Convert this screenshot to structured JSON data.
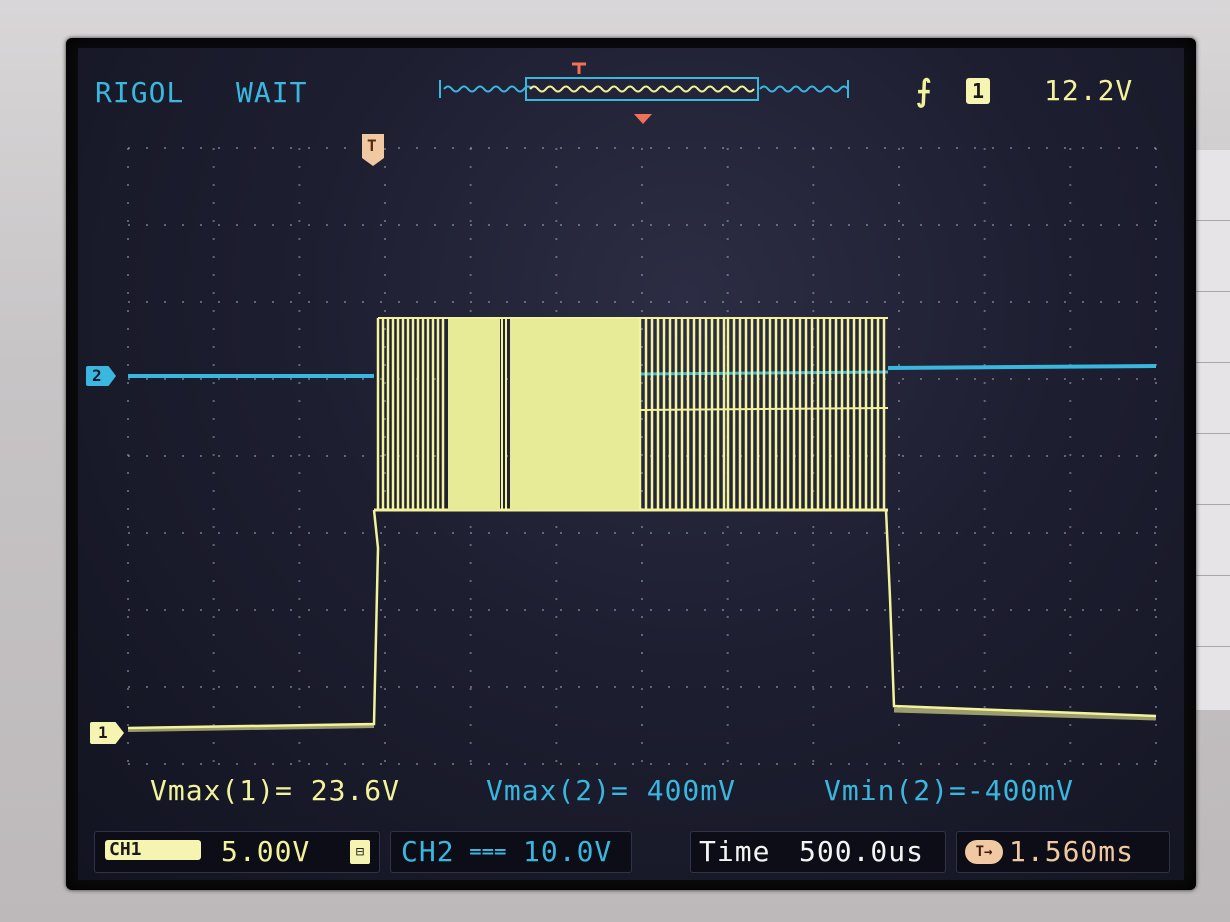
{
  "header": {
    "brand": "RIGOL",
    "status": "WAIT",
    "trigger_edge_icon": "rising-edge-icon",
    "trigger_source": "1",
    "trigger_level": "12.2V"
  },
  "markers": {
    "top_trigger": "T",
    "trigger_marker": "T",
    "ch2_marker": "2",
    "ch1_marker": "1"
  },
  "measurements": {
    "vmax1": "Vmax(1)= 23.6V",
    "vmax2": "Vmax(2)= 400mV",
    "vmin2": "Vmin(2)=-400mV"
  },
  "status_bar": {
    "ch1_label": "CH1",
    "ch1_scale": "5.00V",
    "ch1_coupling_icon": "bandwidth-limit-icon",
    "ch2_label": "CH2",
    "ch2_coupling_icon": "dc-coupling-icon",
    "ch2_scale": "10.0V",
    "time_label": "Time",
    "time_scale": "500.0us",
    "trigger_offset_icon": "trigger-offset-icon",
    "trigger_offset": "1.560ms"
  },
  "colors": {
    "ch1": "#f2f39a",
    "ch2": "#39b7df",
    "text_cyan": "#39b7df",
    "screen_bg": "#1d1e30"
  }
}
